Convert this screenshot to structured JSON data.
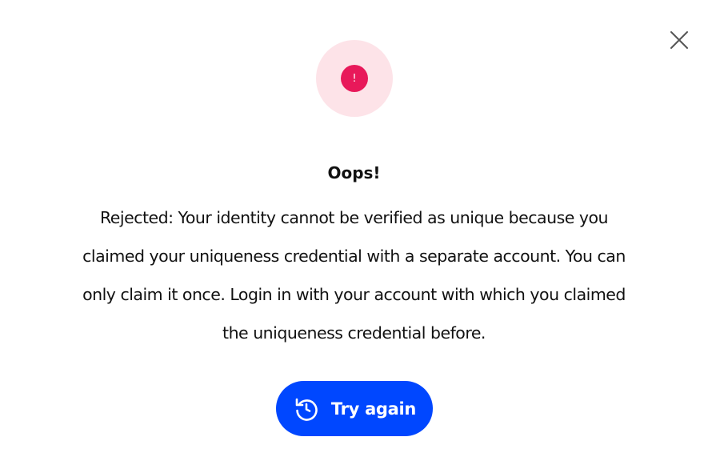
{
  "dialog": {
    "close_icon": "close-icon",
    "status_icon": "error-alert-icon",
    "status_symbol": "!",
    "title": "Oops!",
    "message": "Rejected: Your identity cannot be verified as unique because you claimed your uniqueness credential with a separate account. You can only claim it once. Login in with your account with which you claimed the uniqueness credential before.",
    "retry_button": {
      "label": "Try again",
      "icon": "retry-icon"
    }
  },
  "colors": {
    "accent": "#0047ff",
    "error": "#e8195a",
    "error_bg": "#fde3e8",
    "text": "#111111",
    "close_icon": "#555555"
  }
}
